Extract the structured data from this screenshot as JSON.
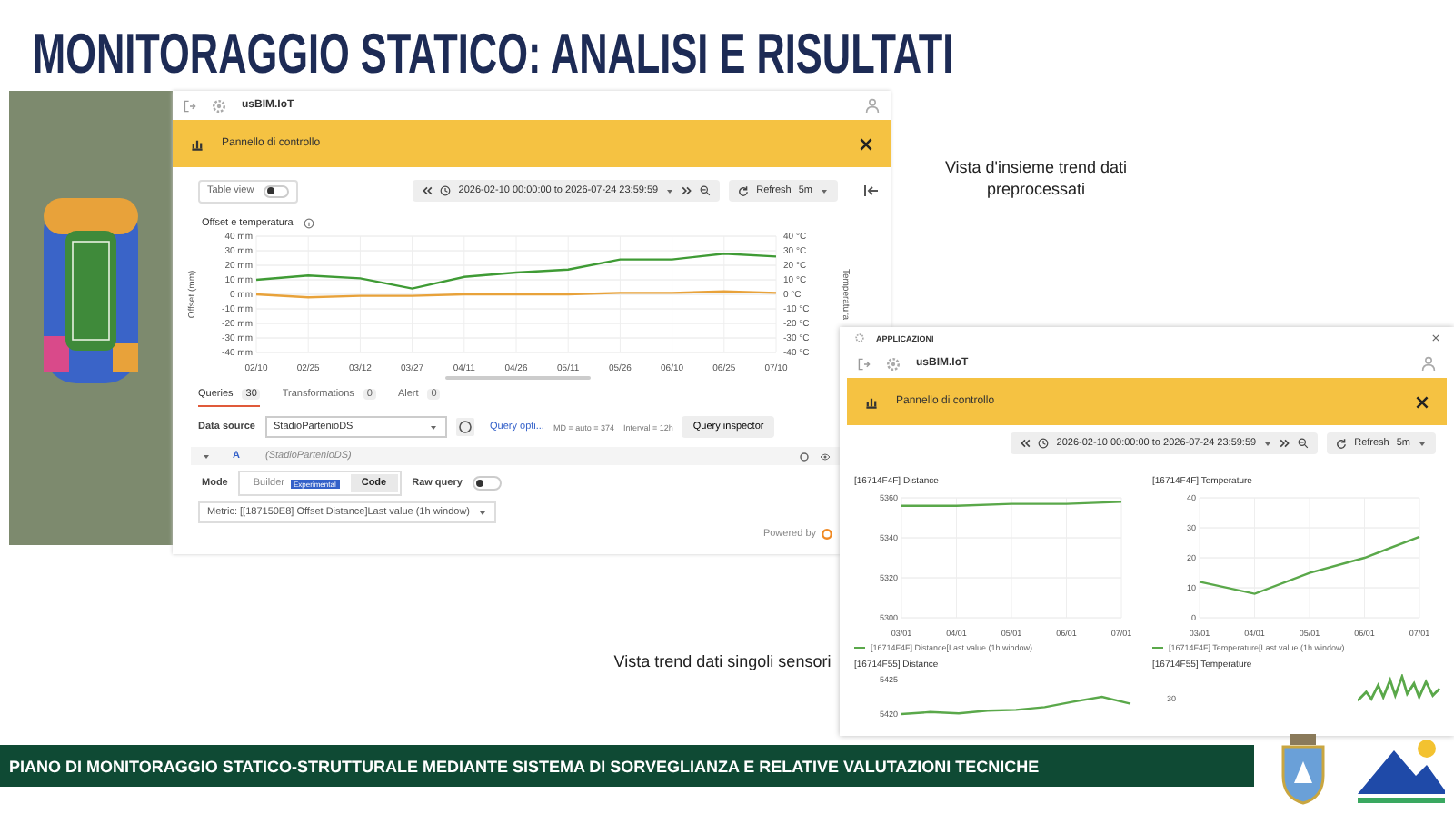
{
  "title": "MONITORAGGIO STATICO: ANALISI E RISULTATI",
  "main_window": {
    "app_name": "usBIM.IoT",
    "panel_bar_title": "Pannello di controllo",
    "toolbar": {
      "table_view": {
        "label": "Table view",
        "on": false
      },
      "time_range": "2026-02-10 00:00:00 to 2026-07-24 23:59:59",
      "refresh": "Refresh",
      "interval": "5m"
    },
    "panel": {
      "title": "Offset e temperatura",
      "right_axis": {
        "title": "Temperatura",
        "ticks": [
          "40 °C",
          "30 °C",
          "20 °C",
          "10 °C",
          "0 °C",
          "-10 °C",
          "-20 °C",
          "-30 °C",
          "-40 °C"
        ]
      },
      "chart_data": {
        "type": "line",
        "ylabel": "Offset (mm)",
        "categories": [
          "02/10",
          "02/25",
          "03/12",
          "03/27",
          "04/11",
          "04/26",
          "05/11",
          "05/26",
          "06/10",
          "06/25",
          "07/10"
        ],
        "yticks": [
          {
            "value": -40,
            "label": "-40 mm"
          },
          {
            "value": -30,
            "label": "-30 mm"
          },
          {
            "value": -20,
            "label": "-20 mm"
          },
          {
            "value": -10,
            "label": "-10 mm"
          },
          {
            "value": 0,
            "label": "0 mm"
          },
          {
            "value": 10,
            "label": "10 mm"
          },
          {
            "value": 20,
            "label": "20 mm"
          },
          {
            "value": 30,
            "label": "30 mm"
          },
          {
            "value": 40,
            "label": "40 mm"
          }
        ],
        "ylim": [
          -40,
          40
        ],
        "grid": true,
        "series": [
          {
            "color": "#3f9b35",
            "values": [
              10,
              13,
              11,
              4,
              12,
              15,
              17,
              24,
              24,
              28,
              26
            ]
          },
          {
            "color": "#e8a23a",
            "values": [
              0,
              -2,
              -1,
              -1,
              0,
              0,
              0,
              1,
              1,
              2,
              1
            ]
          }
        ]
      }
    },
    "query_tabs": [
      {
        "label": "Queries",
        "count": "30",
        "selected": true
      },
      {
        "label": "Transformations",
        "count": "0",
        "selected": false
      },
      {
        "label": "Alert",
        "count": "0",
        "selected": false
      }
    ],
    "data_source": {
      "label": "Data source",
      "value": "StadioPartenioDS"
    },
    "query_options": {
      "label": "Query opti...",
      "md": "MD = auto = 374",
      "interval": "Interval = 12h"
    },
    "query_inspector": "Query inspector",
    "query": {
      "letter": "A",
      "source": "(StadioPartenioDS)",
      "expanded": true,
      "mode_label": "Mode",
      "modes": [
        {
          "label": "Builder",
          "badge": "Experimental",
          "selected": false
        },
        {
          "label": "Code",
          "selected": true
        }
      ],
      "raw_query": {
        "label": "Raw query",
        "on": false
      },
      "metric": "Metric: [[187150E8] Offset Distance]Last value (1h window)"
    },
    "powered_by": "Powered by"
  },
  "overview_caption": "Vista d'insieme trend dati preprocessati",
  "sensor_window": {
    "header": "APPLICAZIONI",
    "app_name": "usBIM.IoT",
    "panel_bar_title": "Pannello di controllo",
    "time_range": "2026-02-10 00:00:00 to 2026-07-24 23:59:59",
    "refresh": "Refresh",
    "interval": "5m",
    "panels": [
      {
        "title": "[16714F4F] Distance",
        "chart_data": {
          "type": "line",
          "categories": [
            "03/01",
            "04/01",
            "05/01",
            "06/01",
            "07/01"
          ],
          "yticks": [
            5300,
            5320,
            5340,
            5360
          ],
          "ylim": [
            5300,
            5360
          ],
          "grid": true,
          "series": [
            {
              "name": "[16714F4F] Distance[Last value (1h window)",
              "color": "#5aa84a",
              "values": [
                5356,
                5356,
                5357,
                5357,
                5358
              ]
            }
          ]
        }
      },
      {
        "title": "[16714F4F] Temperature",
        "chart_data": {
          "type": "line",
          "categories": [
            "03/01",
            "04/01",
            "05/01",
            "06/01",
            "07/01"
          ],
          "yticks": [
            0,
            10,
            20,
            30,
            40
          ],
          "ylim": [
            0,
            40
          ],
          "grid": true,
          "series": [
            {
              "name": "[16714F4F] Temperature[Last value (1h window)",
              "color": "#5aa84a",
              "values": [
                12,
                8,
                15,
                20,
                27
              ]
            }
          ]
        }
      },
      {
        "title": "[16714F55] Distance",
        "chart_data": {
          "type": "line",
          "yticks": [
            5420,
            5425
          ],
          "ylim": [
            5420,
            5425
          ],
          "series": [
            {
              "color": "#5aa84a",
              "values": [
                5420,
                5420.3,
                5420.1,
                5420.5,
                5420.6,
                5421,
                5421.8,
                5422.5,
                5421.5
              ]
            }
          ]
        }
      },
      {
        "title": "[16714F55] Temperature",
        "tick_label": "30"
      }
    ]
  },
  "sensors_caption": "Vista trend dati singoli sensori",
  "footer": "PIANO DI MONITORAGGIO STATICO-STRUTTURALE MEDIANTE SISTEMA DI SORVEGLIANZA E RELATIVE VALUTAZIONI TECNICHE"
}
